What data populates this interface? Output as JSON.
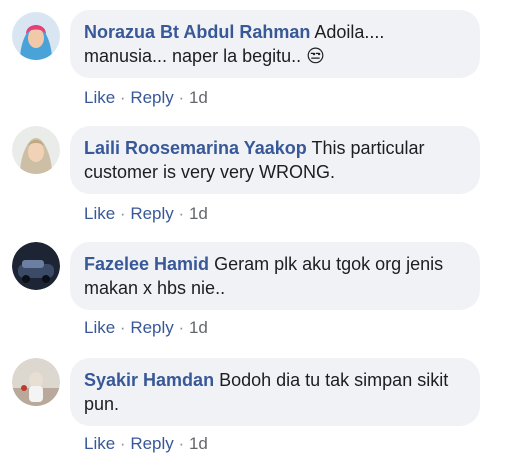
{
  "comments": [
    {
      "author": "Norazua Bt Abdul Rahman",
      "text": "Adoila.... manusia... naper la begitu.. 😒",
      "like": "Like",
      "reply": "Reply",
      "sep": "·",
      "time": "1d",
      "avatar_icon": "profile-photo-woman-hijab-blue"
    },
    {
      "author": "Laili Roosemarina Yaakop",
      "text": "This particular customer is very very WRONG.",
      "like": "Like",
      "reply": "Reply",
      "sep": "·",
      "time": "1d",
      "avatar_icon": "profile-photo-woman-hijab-light"
    },
    {
      "author": "Fazelee Hamid",
      "text": "Geram plk aku tgok org jenis makan x hbs nie..",
      "like": "Like",
      "reply": "Reply",
      "sep": "·",
      "time": "1d",
      "avatar_icon": "profile-photo-dark-car"
    },
    {
      "author": "Syakir Hamdan",
      "text": "Bodoh dia tu tak simpan sikit pun.",
      "like": "Like",
      "reply": "Reply",
      "sep": "·",
      "time": "1d",
      "avatar_icon": "profile-photo-outdoor"
    }
  ],
  "colors": {
    "bubble": "#f0f2f5",
    "author": "#385898",
    "text": "#1c1e21",
    "meta": "#65676b"
  }
}
